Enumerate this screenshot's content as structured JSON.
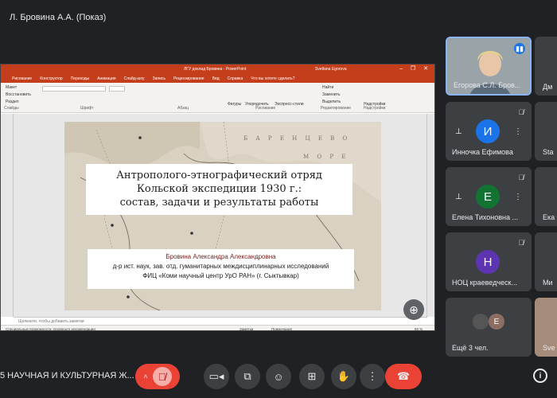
{
  "meeting": {
    "presenter_label": "Л. Бровина А.А. (Показ)",
    "name": "5 НАУЧНАЯ И КУЛЬТУРНАЯ Ж..."
  },
  "powerpoint": {
    "window_title": "ЛГУ доклад Бровина  -  PowerPoint",
    "user": "Svetlana Egorova",
    "window_controls": "–  ❐  ✕",
    "tabs": [
      "Рисование",
      "Конструктор",
      "Переходы",
      "Анимация",
      "Слайд-шоу",
      "Запись",
      "Рецензирование",
      "Вид",
      "Справка",
      "Что вы хотите сделать?"
    ],
    "ribbon": {
      "layout": "Макет",
      "restore": "Восстановить",
      "section": "Раздел",
      "slides_label": "Слайды",
      "font_label": "Шрифт",
      "paragraph_label": "Абзац",
      "shapes": "Фигуры",
      "arrange": "Упорядочить",
      "quick_styles": "Экспресс-стили",
      "drawing_label": "Рисование",
      "find": "Найти",
      "replace": "Заменить",
      "select": "Выделить",
      "editing_label": "Редактирование",
      "designer": "Надстройки",
      "designer_label": "Надстройки"
    },
    "notes_placeholder": "Щелкните, чтобы добавить заметки",
    "status": {
      "accessibility": "Специальные возможности: проверьте рекомендации",
      "notes": "Заметки",
      "comments": "Примечания",
      "zoom": "90 %"
    },
    "slide": {
      "sea_label_1": "Б А Р Е Н Ц Е В О",
      "sea_label_2": "М О Р Е",
      "title_line1": "Антрополого-этнографический отряд",
      "title_line2": "Кольской экспедиции 1930 г.:",
      "title_line3": "состав, задачи и результаты работы",
      "author_name": "Бровина Александра Александровна",
      "author_line2": "д-р ист. наук, зав. отд. гуманитарных междисциплинарных исследований",
      "author_line3": "ФИЦ «Коми научный центр УрО РАН» (г. Сыктывкар)"
    }
  },
  "participants": [
    {
      "name": "Егорова С.Л. Бров...",
      "initial": ""
    },
    {
      "name": "Инночка Ефимова",
      "initial": "И",
      "color": "#1a73e8"
    },
    {
      "name": "Елена Тихоновна ...",
      "initial": "Е",
      "color": "#137333"
    },
    {
      "name": "НОЦ краеведческ...",
      "initial": "Н",
      "color": "#5e35b1"
    },
    {
      "name": "Ещё 3 чел.",
      "initial": "Е",
      "color": "#8d6e63"
    }
  ],
  "partial_tiles": [
    "Дм",
    "Sta",
    "Ека",
    "Ми",
    "Sve"
  ],
  "controls": [
    "raise-hand",
    "mic-off",
    "camera",
    "captions",
    "emoji",
    "present",
    "hand",
    "more",
    "end-call"
  ],
  "colors": {
    "ppt_red": "#c43e1c",
    "meet_bg": "#202124",
    "tile_bg": "#3c4043",
    "danger": "#ea4335"
  }
}
